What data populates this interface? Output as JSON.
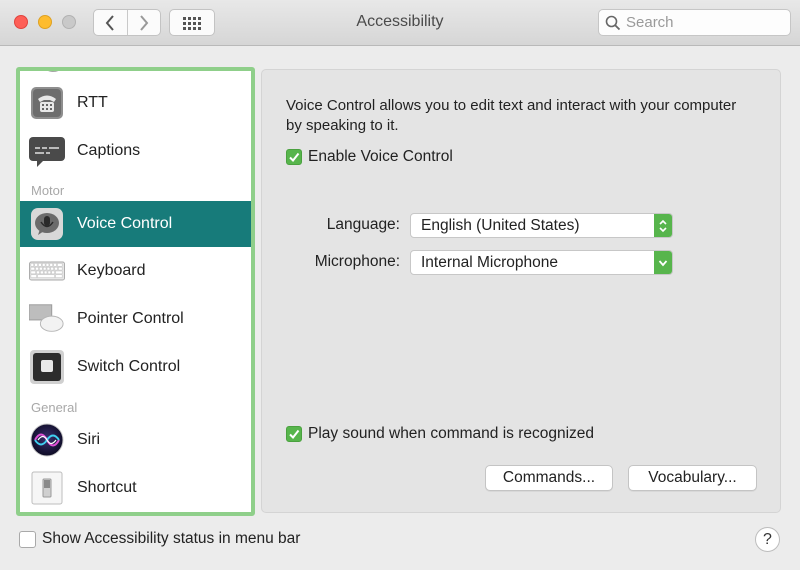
{
  "window": {
    "title": "Accessibility"
  },
  "toolbar": {
    "back_icon": "chevron-left-icon",
    "forward_icon": "chevron-right-icon",
    "show_all_icon": "grid-icon"
  },
  "search": {
    "placeholder": "Search",
    "value": ""
  },
  "sidebar": {
    "items": [
      {
        "label": "RTT",
        "icon": "rtt-icon"
      },
      {
        "label": "Captions",
        "icon": "captions-icon"
      },
      {
        "label": "Voice Control",
        "icon": "voice-control-icon",
        "selected": true
      },
      {
        "label": "Keyboard",
        "icon": "keyboard-icon"
      },
      {
        "label": "Pointer Control",
        "icon": "pointer-control-icon"
      },
      {
        "label": "Switch Control",
        "icon": "switch-control-icon"
      },
      {
        "label": "Siri",
        "icon": "siri-icon"
      },
      {
        "label": "Shortcut",
        "icon": "shortcut-icon"
      }
    ],
    "sections": {
      "motor": "Motor",
      "general": "General"
    }
  },
  "main": {
    "description": "Voice Control allows you to edit text and interact with your computer by speaking to it.",
    "enable_voice_control": {
      "label": "Enable Voice Control",
      "checked": true
    },
    "language": {
      "label": "Language:",
      "value": "English (United States)"
    },
    "microphone": {
      "label": "Microphone:",
      "value": "Internal Microphone"
    },
    "play_sound": {
      "label": "Play sound when command is recognized",
      "checked": true
    },
    "commands_button": "Commands...",
    "vocabulary_button": "Vocabulary..."
  },
  "footer": {
    "show_status": {
      "label": "Show Accessibility status in menu bar",
      "checked": false
    },
    "help_label": "?"
  },
  "colors": {
    "selection": "#177b7a",
    "focus_ring": "#8fcf8a",
    "checkbox": "#57b54c"
  }
}
